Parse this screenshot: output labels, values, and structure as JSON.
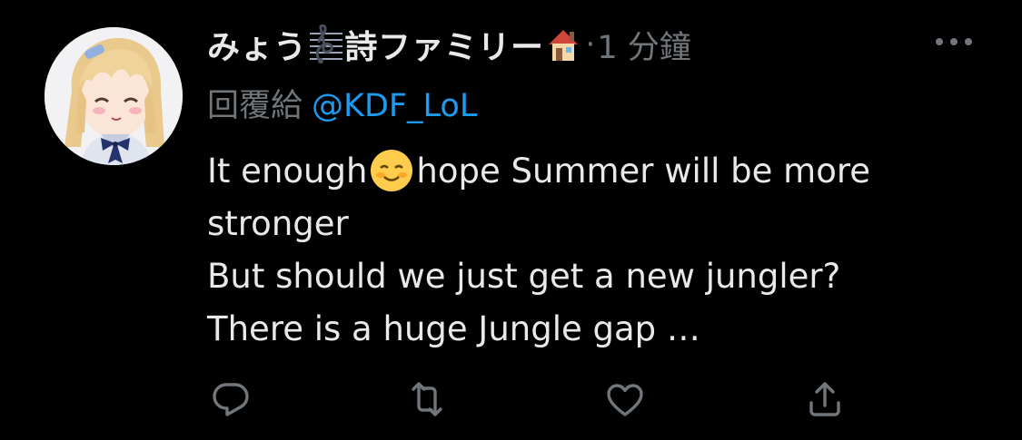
{
  "tweet": {
    "author": {
      "display_name_part1": "みょう",
      "display_name_part2": "詩ファミリー",
      "name_emoji_1": "musical-score-emoji",
      "name_emoji_2": "house-emoji",
      "avatar_icon": "anime-girl-avatar"
    },
    "separator": "·",
    "timestamp": "1 分鐘",
    "reply_prefix": "回覆給",
    "reply_handle": "@KDF_LoL",
    "body": {
      "line1_a": "It enough",
      "line1_emoji": "smiling-face-emoji",
      "line1_b": "hope Summer will be more",
      "line2": "stronger",
      "line3": "But should we just get a new jungler?",
      "line4": "There is a huge Jungle gap …"
    },
    "actions": [
      "reply-icon",
      "retweet-icon",
      "like-icon",
      "share-icon"
    ],
    "more": "more-options-icon"
  },
  "colors": {
    "background": "#000000",
    "text_primary": "#e7e9ea",
    "text_secondary": "#71767b",
    "link": "#1d9bf0"
  }
}
